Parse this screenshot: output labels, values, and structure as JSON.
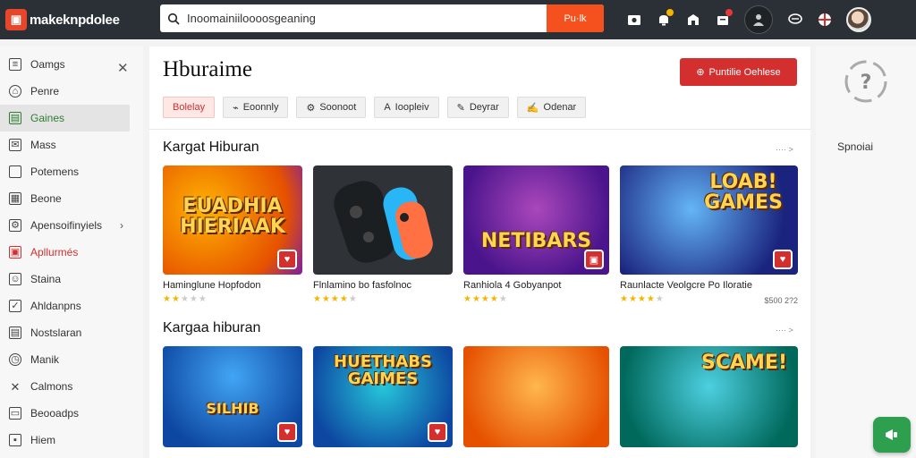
{
  "app": {
    "name": "makeknpdolee"
  },
  "search": {
    "value": "Inoomainiiloooosgeaning",
    "button_label": "Pu·lk"
  },
  "sidebar": {
    "items": [
      {
        "label": "Oamgs"
      },
      {
        "label": "Penre"
      },
      {
        "label": "Gaines"
      },
      {
        "label": "Mass"
      },
      {
        "label": "Potemens"
      },
      {
        "label": "Beone"
      },
      {
        "label": "Apensoifinyiels"
      },
      {
        "label": "Apllurmés"
      },
      {
        "label": "Staina"
      },
      {
        "label": "Ahldanpns"
      },
      {
        "label": "Nostslaran"
      },
      {
        "label": "Manik"
      },
      {
        "label": "Calmons"
      },
      {
        "label": "Beooadps"
      },
      {
        "label": "Hiem"
      }
    ]
  },
  "main": {
    "title": "Hburaime",
    "primary_button": "Puntilie Oehlese",
    "filters": [
      {
        "label": "Bolelay"
      },
      {
        "label": "Eoonnly"
      },
      {
        "label": "Soonoot"
      },
      {
        "label": "Ioopleiv"
      },
      {
        "label": "Deyrar"
      },
      {
        "label": "Odenar"
      }
    ],
    "sections": [
      {
        "title": "Kargat Hiburan",
        "more": "···· >",
        "cards": [
          {
            "thumb_text": "EUADHIA HIERIAAK",
            "title": "Haminglune Hopfodon",
            "rating": 2,
            "price": ""
          },
          {
            "thumb_text": "",
            "title": "Flnlamino bo fasfolnoc",
            "rating": 4,
            "price": ""
          },
          {
            "thumb_text": "NETIBARS",
            "title": "Ranhiola 4 Gobyanpot",
            "rating": 4,
            "price": ""
          },
          {
            "thumb_text": "LOAB! GAMES",
            "title": "Raunlacte Veolgcre Po Iloratie",
            "rating": 4,
            "price": "$500 2?2"
          }
        ]
      },
      {
        "title": "Kargaa hiburan",
        "more": "···· >",
        "cards": [
          {
            "thumb_text": "SILHIB",
            "title": "",
            "rating": 0,
            "price": ""
          },
          {
            "thumb_text": "HUETHABS GAIMES",
            "title": "",
            "rating": 0,
            "price": ""
          },
          {
            "thumb_text": "",
            "title": "",
            "rating": 0,
            "price": ""
          },
          {
            "thumb_text": "SCAME!",
            "title": "",
            "rating": 0,
            "price": ""
          }
        ]
      }
    ]
  },
  "right_panel": {
    "label": "Spnoiai"
  },
  "colors": {
    "accent": "#d32f2f",
    "search_button": "#f4511e",
    "active_green": "#2e7d32",
    "fab": "#2e9e4f"
  }
}
